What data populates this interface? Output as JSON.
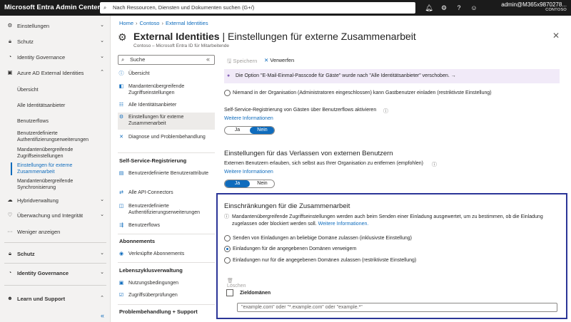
{
  "topbar": {
    "brand": "Microsoft Entra Admin Center",
    "search_placeholder": "Nach Ressourcen, Diensten und Dokumenten suchen (G+/)",
    "account_name": "admin@M365x9870278...",
    "account_tenant": "CONTOSO"
  },
  "leftnav": {
    "items": [
      {
        "label": "Einstellungen",
        "chev": "⌄"
      },
      {
        "label": "Schutz",
        "chev": "⌄"
      },
      {
        "label": "Identity Governance",
        "chev": "⌄"
      },
      {
        "label": "Azure AD External Identities",
        "chev": "⌃"
      }
    ],
    "sub": [
      "Übersicht",
      "Alle Identitätsanbieter",
      "Benutzerflows",
      "Benutzerdefinierte Authentifizierungserweiterungen",
      "Mandantenübergreifende Zugriffseinstellungen",
      "Einstellungen für externe Zusammenarbeit",
      "Mandantenübergreifende Synchronisierung"
    ],
    "items2": [
      {
        "label": "Hybridverwaltung",
        "chev": "⌄"
      },
      {
        "label": "Überwachung und Integrität",
        "chev": "⌄"
      },
      {
        "label": "Weniger anzeigen",
        "chev": ""
      }
    ],
    "items3": [
      {
        "label": "Schutz",
        "chev": "⌄"
      },
      {
        "label": "Identity Governance",
        "chev": "⌄"
      },
      {
        "label": "Learn und Support",
        "chev": "⌃"
      }
    ],
    "collapse": "«"
  },
  "breadcrumb": [
    "Home",
    "Contoso",
    "External Identities"
  ],
  "page": {
    "title_bold": "External Identities",
    "title_rest": " | Einstellungen für externe Zusammenarbeit",
    "subtitle": "Contoso – Microsoft Entra ID für Mitarbeitende",
    "more": "···",
    "close": "✕"
  },
  "menu": {
    "search": "Suche",
    "collapse": "«",
    "items": [
      {
        "label": "Übersicht",
        "icon": "ⓘ"
      },
      {
        "label": "Mandantenübergreifende Zugriffseinstellungen",
        "icon": "◧"
      },
      {
        "label": "Alle Identitätsanbieter",
        "icon": "☷"
      },
      {
        "label": "Einstellungen für externe Zusammenarbeit",
        "icon": "⚙"
      },
      {
        "label": "Diagnose und Problembehandlung",
        "icon": "✕"
      }
    ],
    "section1": "Self-Service-Registrierung",
    "items1": [
      {
        "label": "Benutzerdefinierte Benutzerattribute",
        "icon": "▤"
      },
      {
        "label": "Alle API-Connectors",
        "icon": "⇄"
      },
      {
        "label": "Benutzerdefinierte Authentifizierungserweiterungen",
        "icon": "◫"
      },
      {
        "label": "Benutzerflows",
        "icon": "⇶"
      }
    ],
    "section2": "Abonnements",
    "items2": [
      {
        "label": "Verknüpfte Abonnements",
        "icon": "◉"
      }
    ],
    "section3": "Lebenszyklusverwaltung",
    "items3": [
      {
        "label": "Nutzungsbedingungen",
        "icon": "▣"
      },
      {
        "label": "Zugriffsüberprüfungen",
        "icon": "☑"
      }
    ],
    "section4": "Problembehandlung + Support"
  },
  "commands": {
    "save": "Speichern",
    "discard": "Verwerfen"
  },
  "content": {
    "banner": "Die Option \"E-Mail-Einmal-Passcode für Gäste\" wurde nach \"Alle Identitätsanbieter\" verschoben.  →",
    "radio_none": "Niemand in der Organisation (Administratoren eingeschlossen) kann Gastbenutzer einladen (restriktivste Einstellung)",
    "ssr_label": "Self-Service-Registrierung von Gästen über Benutzerflows aktivieren",
    "more_info": "Weitere Informationen",
    "yes": "Ja",
    "no": "Nein",
    "leave_title": "Einstellungen für das Verlassen von externen Benutzern",
    "leave_text": "Externen Benutzern erlauben, sich selbst aus Ihrer Organisation zu entfernen (empfohlen)",
    "collab_title": "Einschränkungen für die Zusammenarbeit",
    "collab_info1": "Mandantenübergreifende Zugriffseinstellungen werden auch beim Senden einer Einladung ausgewertet, um zu bestimmen, ob die Einladung",
    "collab_info2": "zugelassen oder blockiert werden soll.",
    "collab_link": "Weitere Informationen.",
    "opt1": "Senden von Einladungen an beliebige Domäne zulassen (inklusivste Einstellung)",
    "opt2": "Einladungen für die angegebenen Domänen verweigern",
    "opt3": "Einladungen nur für die angegebenen Domänen zulassen (restriktivste Einstellung)",
    "delete": "Löschen",
    "target_domains": "Zieldomänen",
    "domain_placeholder": "\"example.com\" oder \"*.example.com\" oder \"example.*\""
  },
  "colors": {
    "accent": "#0f6cbd",
    "topbar": "#1b1b1b",
    "highlight_border": "#2b3597"
  }
}
